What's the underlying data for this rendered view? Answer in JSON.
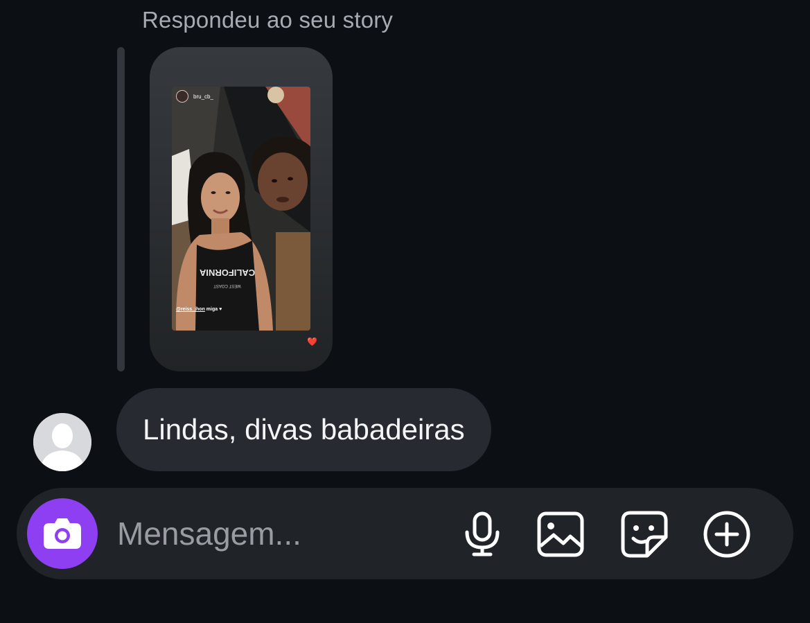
{
  "reply": {
    "label": "Respondeu ao seu story"
  },
  "story": {
    "username": "bru_cb_",
    "caption_mention": "@reiss_jhon",
    "caption_text": " miga ♥",
    "shirt_text": "CALIFORNIA",
    "shirt_subtext": "WEST COAST",
    "reaction": "❤️"
  },
  "message": {
    "text": "Lindas, divas babadeiras"
  },
  "composer": {
    "placeholder": "Mensagem...",
    "value": "",
    "icons": [
      "camera-icon",
      "microphone-icon",
      "gallery-icon",
      "sticker-icon",
      "plus-icon"
    ]
  },
  "colors": {
    "background": "#0c0f14",
    "bubble": "#272a30",
    "composer": "#202327",
    "camera_accent": "#8e3ff2",
    "secondary_text": "#a8abb3"
  }
}
